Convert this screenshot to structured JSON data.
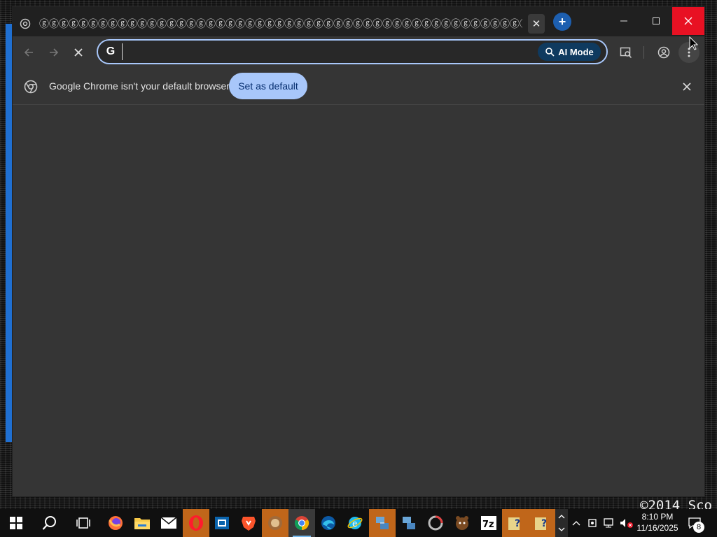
{
  "window": {
    "tab_title": "ⓖⓖⓖⓖⓖⓖⓖⓖⓖⓖⓖⓖⓖⓖⓖⓖⓖⓖⓖⓖⓖⓖⓖⓖⓖⓖⓖⓖⓖⓖⓖⓖⓖⓖⓖⓖⓖⓖⓖⓖⓖⓖⓖⓖⓖⓖⓖⓖⓖⓖⓖⓖⓖⓖ",
    "tab_close_label": "✕",
    "new_tab_label": "+"
  },
  "toolbar": {
    "omnibox_value": "",
    "ai_mode_label": "AI Mode"
  },
  "infobar": {
    "message": "Google Chrome isn't your default browser",
    "set_default_label": "Set as default"
  },
  "watermark": "©2014 Sco",
  "taskbar": {
    "icons": [
      "windows-start-icon",
      "search-icon",
      "task-view-icon",
      "firefox-icon",
      "file-explorer-icon",
      "mail-icon",
      "opera-icon",
      "outlook-icon",
      "brave-icon",
      "app-icon",
      "chrome-icon",
      "edge-icon",
      "ie-icon",
      "network-app-icon",
      "network-app-icon-2",
      "app-icon-2",
      "fnaf-icon",
      "7zip-icon",
      "help-icon",
      "help-icon-2"
    ],
    "time": "8:10 PM",
    "date": "11/16/2025",
    "notification_count": "8"
  },
  "colors": {
    "accent_blue": "#a8c7fa",
    "close_red": "#e81123",
    "window_bg": "#353535",
    "titlebar_bg": "#202020"
  }
}
